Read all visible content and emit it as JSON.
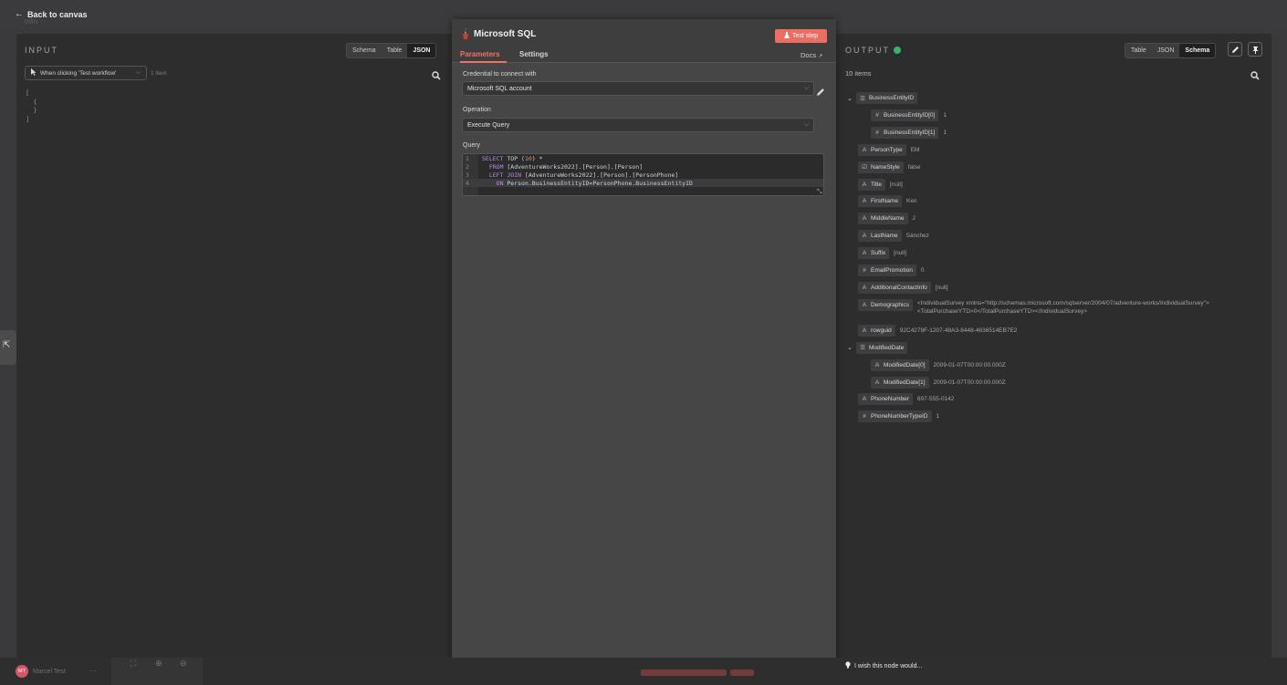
{
  "topbar": {
    "back_label": "Back to canvas",
    "ghost_logo": "n8n"
  },
  "input_panel": {
    "title": "INPUT",
    "views": [
      "Schema",
      "Table",
      "JSON"
    ],
    "active_view": "JSON",
    "trigger_select": "When clicking 'Test workflow'",
    "item_count": "1 item",
    "json_lines": [
      "[",
      "  {",
      "  }",
      "]"
    ]
  },
  "node": {
    "title": "Microsoft SQL",
    "test_button": "Test step",
    "tabs": {
      "parameters": "Parameters",
      "settings": "Settings"
    },
    "docs_label": "Docs",
    "credential_label": "Credential to connect with",
    "credential_value": "Microsoft SQL account",
    "operation_label": "Operation",
    "operation_value": "Execute Query",
    "query_label": "Query",
    "query_lines": [
      {
        "num": "1",
        "text": "SELECT TOP (10) *"
      },
      {
        "num": "2",
        "text": "  FROM [AdventureWorks2022].[Person].[Person]"
      },
      {
        "num": "3",
        "text": "  LEFT JOIN [AdventureWorks2022].[Person].[PersonPhone]"
      },
      {
        "num": "4",
        "text": "    ON Person.BusinessEntityID=PersonPhone.BusinessEntityID"
      }
    ]
  },
  "output_panel": {
    "title": "OUTPUT",
    "views": [
      "Table",
      "JSON",
      "Schema"
    ],
    "active_view": "Schema",
    "item_count": "10 items",
    "status_color": "#38b26a",
    "schema": [
      {
        "type": "list",
        "name": "BusinessEntityID",
        "value": "",
        "level": 0,
        "toggle": true
      },
      {
        "type": "#",
        "name": "BusinessEntityID[0]",
        "value": "1",
        "level": 1
      },
      {
        "type": "#",
        "name": "BusinessEntityID[1]",
        "value": "1",
        "level": 1
      },
      {
        "type": "A",
        "name": "PersonType",
        "value": "EM",
        "level": 0
      },
      {
        "type": "bool",
        "name": "NameStyle",
        "value": "false",
        "level": 0
      },
      {
        "type": "A",
        "name": "Title",
        "value": "[null]",
        "level": 0
      },
      {
        "type": "A",
        "name": "FirstName",
        "value": "Ken",
        "level": 0
      },
      {
        "type": "A",
        "name": "MiddleName",
        "value": "J",
        "level": 0
      },
      {
        "type": "A",
        "name": "LastName",
        "value": "Sánchez",
        "level": 0
      },
      {
        "type": "A",
        "name": "Suffix",
        "value": "[null]",
        "level": 0
      },
      {
        "type": "#",
        "name": "EmailPromotion",
        "value": "0",
        "level": 0
      },
      {
        "type": "A",
        "name": "AdditionalContactInfo",
        "value": "[null]",
        "level": 0
      },
      {
        "type": "A",
        "name": "Demographics",
        "value": "<IndividualSurvey xmlns=\"http://schemas.microsoft.com/sqlserver/2004/07/adventure-works/IndividualSurvey\"><TotalPurchaseYTD>0</TotalPurchaseYTD></IndividualSurvey>",
        "level": 0,
        "multiline": true
      },
      {
        "type": "A",
        "name": "rowguid",
        "value": "92C4279F-1207-48A3-8448-4636514EB7E2",
        "level": 0
      },
      {
        "type": "list",
        "name": "ModifiedDate",
        "value": "",
        "level": 0,
        "toggle": true
      },
      {
        "type": "A",
        "name": "ModifiedDate[0]",
        "value": "2009-01-07T00:00:00.000Z",
        "level": 1
      },
      {
        "type": "A",
        "name": "ModifiedDate[1]",
        "value": "2009-01-07T00:00:00.000Z",
        "level": 1
      },
      {
        "type": "A",
        "name": "PhoneNumber",
        "value": "697-555-0142",
        "level": 0
      },
      {
        "type": "#",
        "name": "PhoneNumberTypeID",
        "value": "1",
        "level": 0
      }
    ]
  },
  "bottom": {
    "user_initials": "MT",
    "user_name": "Marcel Test",
    "user_more": "···",
    "feedback_label": "I wish this node would..."
  },
  "colors": {
    "accent": "#f07265",
    "test_button": "#ec6d61"
  }
}
